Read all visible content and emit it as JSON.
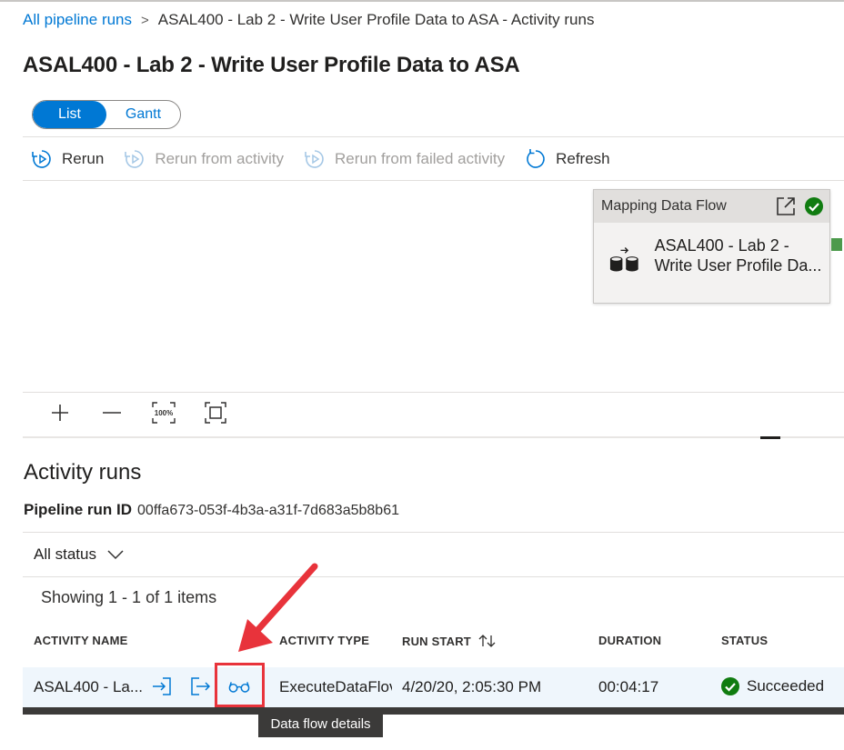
{
  "breadcrumb": {
    "link": "All pipeline runs",
    "separator": ">",
    "current": "ASAL400 - Lab 2 - Write User Profile Data to ASA - Activity runs"
  },
  "page_title": "ASAL400 - Lab 2 - Write User Profile Data to ASA",
  "view_toggle": {
    "list": "List",
    "gantt": "Gantt",
    "selected": "List"
  },
  "toolbar": {
    "rerun": "Rerun",
    "rerun_from_activity": "Rerun from activity",
    "rerun_from_failed": "Rerun from failed activity",
    "refresh": "Refresh"
  },
  "pipeline_node": {
    "type": "Mapping Data Flow",
    "name_line1": "ASAL400 - Lab 2 -",
    "name_line2": "Write User Profile Da...",
    "status_color": "#107c10"
  },
  "zoom_controls": {
    "zoom_label": "100%"
  },
  "activity_runs": {
    "title": "Activity runs",
    "run_id_label": "Pipeline run ID",
    "run_id": "00ffa673-053f-4b3a-a31f-7d683a5b8b61",
    "status_filter": "All status",
    "showing": "Showing 1 - 1 of 1 items",
    "columns": {
      "activity_name": "ACTIVITY NAME",
      "activity_type": "ACTIVITY TYPE",
      "run_start": "RUN START",
      "duration": "DURATION",
      "status": "STATUS"
    },
    "rows": [
      {
        "activity_name": "ASAL400 - La...",
        "activity_type": "ExecuteDataFlov",
        "run_start": "4/20/20, 2:05:30 PM",
        "duration": "00:04:17",
        "status": "Succeeded"
      }
    ]
  },
  "tooltip": "Data flow details",
  "colors": {
    "accent": "#0078d4",
    "success": "#107c10",
    "annotation_red": "#e8333b"
  }
}
